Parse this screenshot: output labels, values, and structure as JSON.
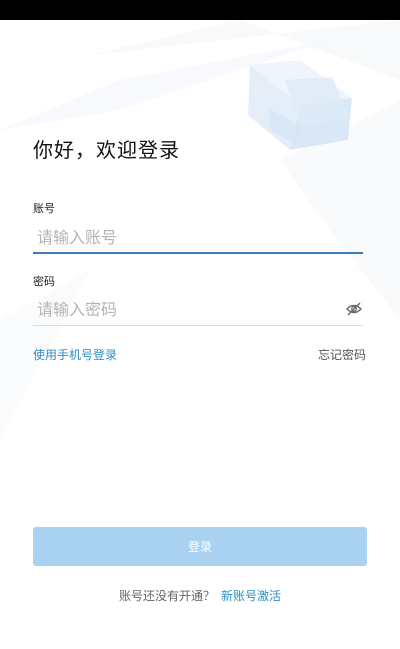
{
  "page": {
    "title": "你好，欢迎登录"
  },
  "form": {
    "account_label": "账号",
    "account_placeholder": "请输入账号",
    "password_label": "密码",
    "password_placeholder": "请输入密码",
    "password_toggle_icon": "eye-off-icon"
  },
  "links": {
    "phone_login": "使用手机号登录",
    "forgot_password": "忘记密码"
  },
  "actions": {
    "login_label": "登录"
  },
  "footer": {
    "question": "账号还没有开通？",
    "activate_link": "新账号激活"
  },
  "colors": {
    "accent": "#2f8fc4",
    "active_underline": "#3a7bb8",
    "button_disabled": "#a9d2f1"
  }
}
